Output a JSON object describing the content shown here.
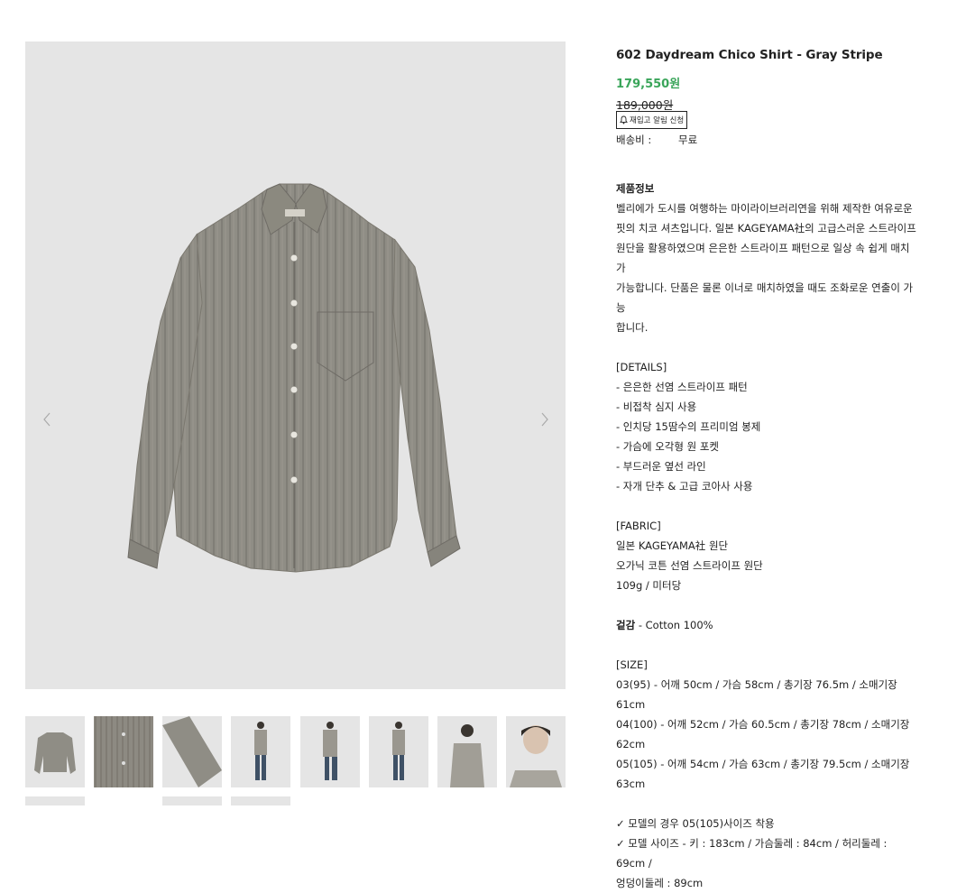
{
  "gallery": {
    "prev_icon": "chevron-left-icon",
    "next_icon": "chevron-right-icon",
    "thumbnails": [
      "thumb-shirt-front",
      "thumb-fabric-detail",
      "thumb-cuff-detail",
      "thumb-model-front",
      "thumb-model-side",
      "thumb-model-back",
      "thumb-model-upper",
      "thumb-model-face"
    ]
  },
  "product": {
    "title": "602 Daydream Chico Shirt - Gray Stripe",
    "sale_price": "179,550원",
    "original_price": "189,000원",
    "restock_label": "재입고 알림 신청",
    "shipping_label": "배송비 :",
    "shipping_value": "무료"
  },
  "description": {
    "info_heading": "제품정보",
    "info_lines": [
      "벨리에가 도시를 여행하는 마이라이브러리연을 위해 제작한 여유로운",
      "핏의 치코 셔츠입니다. 일본 KAGEYAMA社의 고급스러운 스트라이프",
      "원단을 활용하였으며 은은한 스트라이프 패턴으로 일상 속 쉽게 매치가",
      "가능합니다. 단품은 물론 이너로 매치하였을 때도 조화로운 연출이 가능",
      "합니다."
    ],
    "details_heading": "[DETAILS]",
    "details": [
      "- 은은한 선염 스트라이프 패턴",
      "- 비접착 심지 사용",
      "- 인치당 15땀수의 프리미엄 봉제",
      "- 가슴에 오각형 원 포켓",
      "- 부드러운 옆선 라인",
      "- 자개 단추 & 고급 코아사 사용"
    ],
    "fabric_heading": "[FABRIC]",
    "fabric": [
      "일본 KAGEYAMA社 원단",
      "오가닉 코튼 선염 스트라이프 원단",
      "109g / 미터당"
    ],
    "material_label": "겉감",
    "material_value": " - Cotton 100%",
    "size_heading": "[SIZE]",
    "sizes": [
      "03(95) - 어깨 50cm / 가슴 58cm / 총기장 76.5m / 소매기장 61cm",
      "04(100) - 어깨 52cm / 가슴 60.5cm / 총기장 78cm / 소매기장",
      "62cm",
      "05(105) - 어깨 54cm / 가슴 63cm / 총기장 79.5cm / 소매기장",
      "63cm"
    ],
    "model_lines": [
      "✓ 모델의 경우 05(105)사이즈 착용",
      "✓ 모델 사이즈 - 키 : 183cm / 가슴둘레 : 84cm / 허리둘레 : 69cm /",
      "엉덩이둘레 : 89cm"
    ]
  },
  "colors": {
    "sale": "#3aa55a",
    "image_bg": "#e5e5e5",
    "shirt": "#8f8d85"
  }
}
